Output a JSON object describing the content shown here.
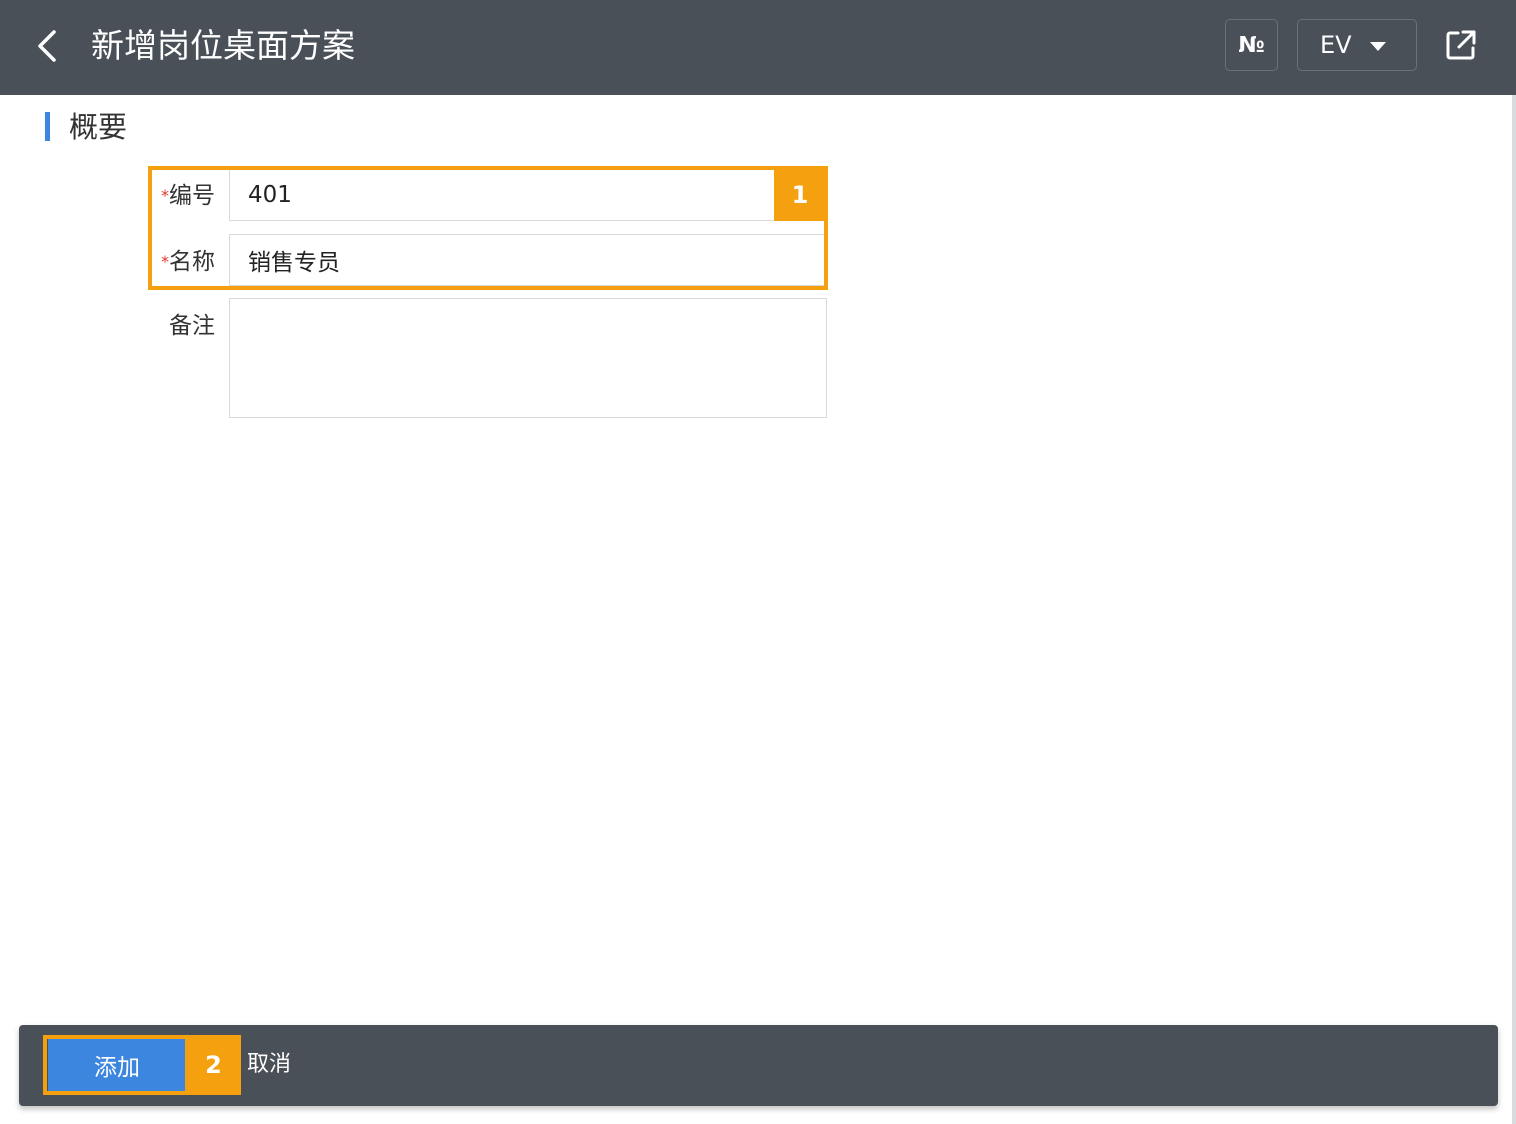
{
  "header": {
    "title": "新增岗位桌面方案",
    "no_badge": "№",
    "language": "EV"
  },
  "section": {
    "title": "概要"
  },
  "form": {
    "code": {
      "required_mark": "*",
      "label": "编号",
      "value": "401"
    },
    "name": {
      "required_mark": "*",
      "label": "名称",
      "value": "销售专员"
    },
    "remark": {
      "label": "备注",
      "value": ""
    }
  },
  "annotations": {
    "step1": "1",
    "step2": "2"
  },
  "actions": {
    "add_label": "添加",
    "cancel_label": "取消"
  },
  "colors": {
    "header_bg": "#4a5058",
    "accent_blue": "#3c86e0",
    "highlight_orange": "#f5a00f",
    "required_red": "#e0392b"
  },
  "icons": {
    "back": "chevron-left-icon",
    "share": "external-link-icon",
    "dropdown": "caret-down-icon"
  }
}
